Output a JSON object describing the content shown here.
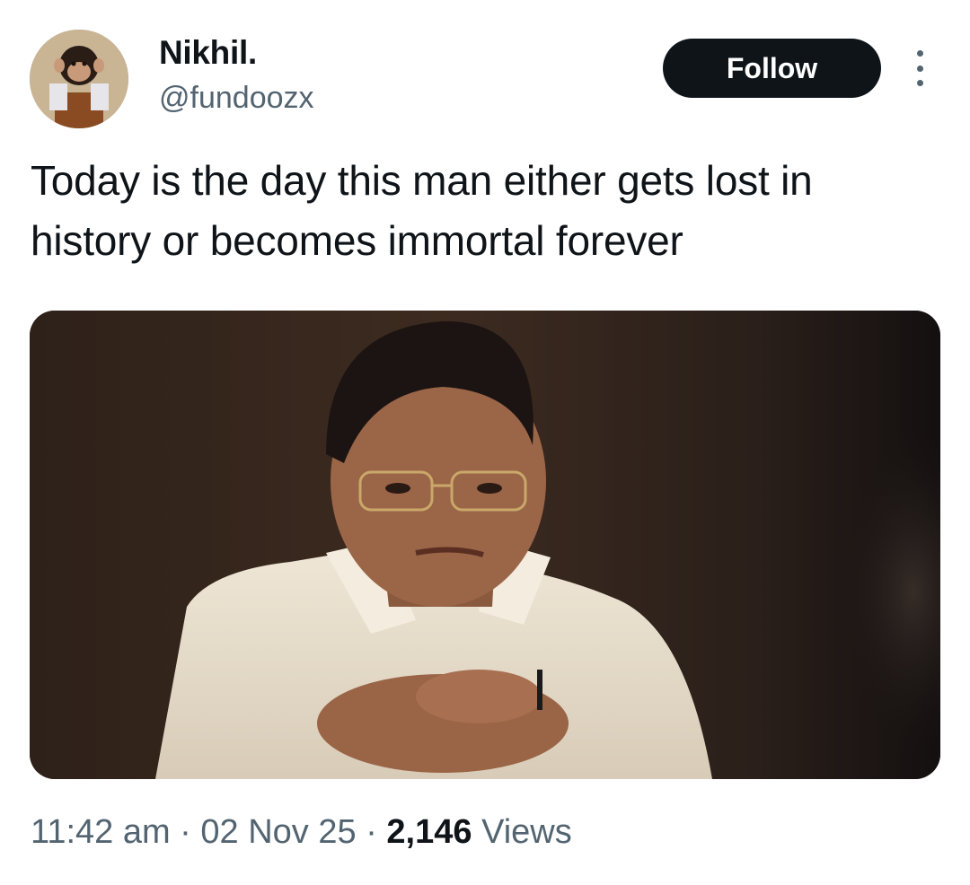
{
  "author": {
    "name": "Nikhil.",
    "handle": "@fundoozx",
    "avatar_icon": "chimpanzee-avatar"
  },
  "actions": {
    "follow_label": "Follow",
    "more_icon": "vertical-ellipsis-icon"
  },
  "tweet": {
    "text": "Today is the day this man either gets lost in history or becomes immortal forever"
  },
  "meta": {
    "time": "11:42 am",
    "sep1": " · ",
    "date": "02 Nov 25",
    "sep2": " · ",
    "views_count": "2,146",
    "views_label": " Views"
  },
  "colors": {
    "text_primary": "#0f1419",
    "text_secondary": "#536471",
    "button_bg": "#0f1419",
    "button_text": "#ffffff"
  }
}
